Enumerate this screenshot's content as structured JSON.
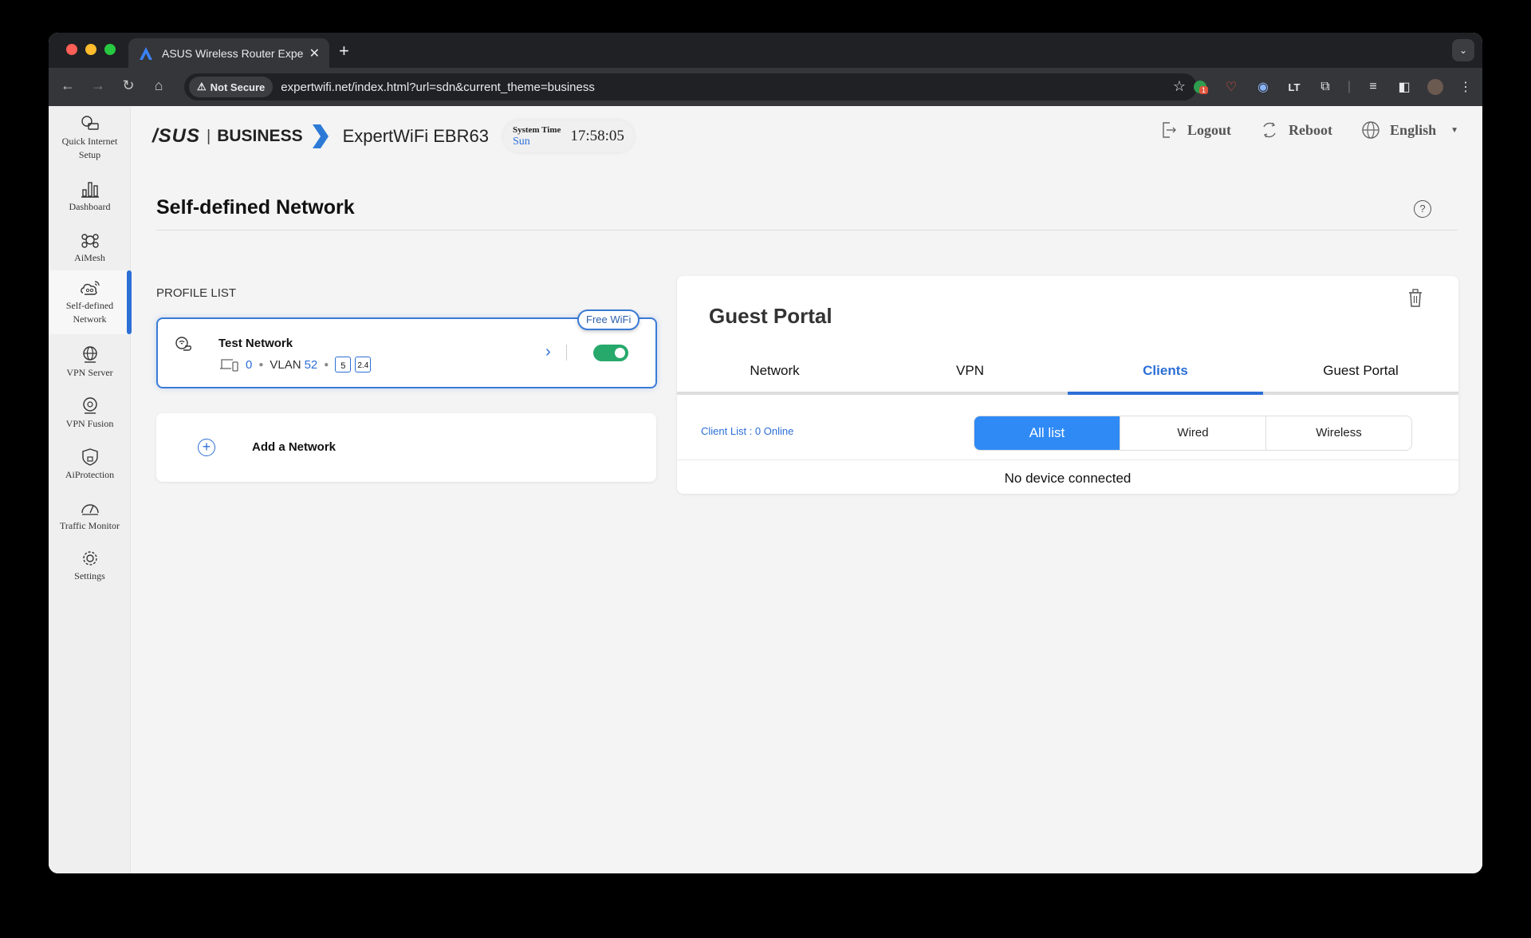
{
  "browser": {
    "tab_title": "ASUS Wireless Router Expert",
    "security_label": "Not Secure",
    "url": "expertwifi.net/index.html?url=sdn&current_theme=business",
    "extension_badge": "1"
  },
  "header": {
    "brand": "/SUS",
    "divider": "|",
    "brand_sub": "BUSINESS",
    "model": "ExpertWiFi EBR63",
    "system_time_label": "System Time",
    "day": "Sun",
    "time": "17:58:05",
    "logout": "Logout",
    "reboot": "Reboot",
    "language": "English"
  },
  "sidebar": {
    "items": [
      {
        "label1": "Quick Internet",
        "label2": "Setup"
      },
      {
        "label1": "Dashboard",
        "label2": ""
      },
      {
        "label1": "AiMesh",
        "label2": ""
      },
      {
        "label1": "Self-defined",
        "label2": "Network"
      },
      {
        "label1": "VPN Server",
        "label2": ""
      },
      {
        "label1": "VPN Fusion",
        "label2": ""
      },
      {
        "label1": "AiProtection",
        "label2": ""
      },
      {
        "label1": "Traffic Monitor",
        "label2": ""
      },
      {
        "label1": "Settings",
        "label2": ""
      }
    ],
    "active_index": 3
  },
  "page": {
    "title": "Self-defined Network",
    "help": "?",
    "profile_list_label": "PROFILE LIST"
  },
  "profile": {
    "name": "Test Network",
    "badge": "Free WiFi",
    "clients": "0",
    "vlan_label": "VLAN",
    "vlan_id": "52",
    "bands": [
      "5",
      "2.4"
    ],
    "enabled": true
  },
  "add_network": {
    "label": "Add a Network"
  },
  "detail": {
    "title": "Guest Portal",
    "tabs": [
      "Network",
      "VPN",
      "Clients",
      "Guest Portal"
    ],
    "active_tab": "Clients",
    "client_list": "Client List : 0 Online",
    "filters": [
      "All list",
      "Wired",
      "Wireless"
    ],
    "active_filter": "All list",
    "empty_message": "No device connected"
  },
  "colors": {
    "accent": "#2c6fd6",
    "toggle_on": "#27a96c",
    "segment_active": "#2f8af5"
  }
}
